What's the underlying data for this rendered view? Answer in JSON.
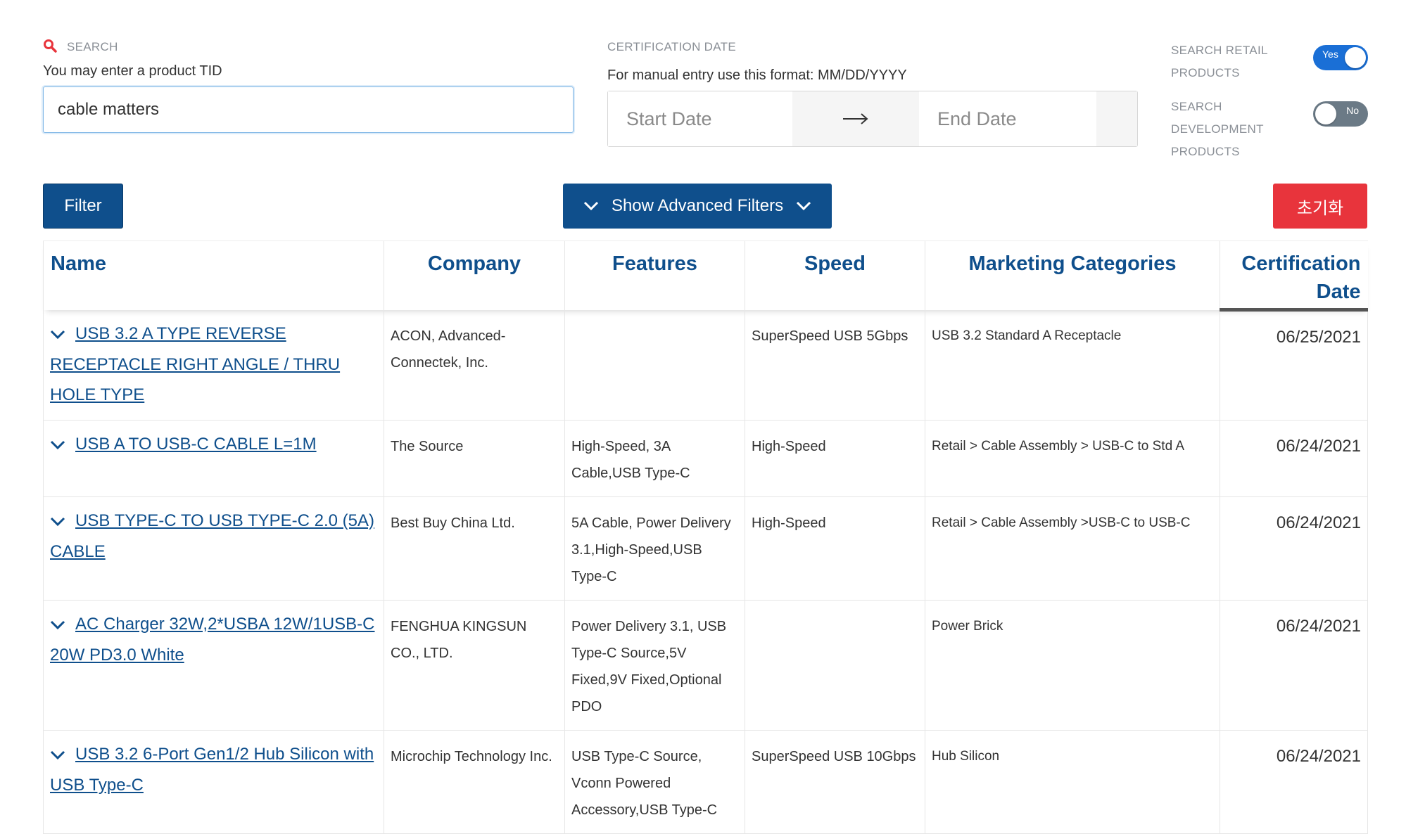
{
  "search": {
    "label": "SEARCH",
    "hint": "You may enter a product TID",
    "value": "cable matters"
  },
  "cert_date": {
    "label": "CERTIFICATION DATE",
    "hint": "For manual entry use this format: MM/DD/YYYY",
    "start_placeholder": "Start Date",
    "end_placeholder": "End Date"
  },
  "toggles": {
    "retail_label": "SEARCH RETAIL PRODUCTS",
    "retail_state": "Yes",
    "dev_label": "SEARCH DEVELOPMENT PRODUCTS",
    "dev_state": "No"
  },
  "buttons": {
    "filter": "Filter",
    "advanced": "Show Advanced Filters",
    "reset": "초기화"
  },
  "colors": {
    "primary": "#0f4f8c",
    "reset": "#e8343c",
    "toggle_on": "#1a6fd6",
    "toggle_off": "#6b7a86"
  },
  "table": {
    "headers": [
      "Name",
      "Company",
      "Features",
      "Speed",
      "Marketing Categories",
      "Certification Date"
    ],
    "rows": [
      {
        "name": "USB 3.2 A TYPE REVERSE RECEPTACLE RIGHT ANGLE / THRU HOLE TYPE",
        "company": "ACON, Advanced-Connectek, Inc.",
        "features": "",
        "speed": "SuperSpeed USB 5Gbps",
        "categories": "USB 3.2 Standard A Receptacle",
        "date": "06/25/2021"
      },
      {
        "name": "USB A TO USB-C CABLE L=1M",
        "company": "The Source",
        "features": "High-Speed, 3A Cable,USB Type-C",
        "speed": "High-Speed",
        "categories": "Retail > Cable Assembly > USB-C to Std A",
        "date": "06/24/2021"
      },
      {
        "name": "USB TYPE-C TO USB TYPE-C 2.0 (5A) CABLE",
        "company": "Best Buy China Ltd.",
        "features": "5A Cable, Power Delivery 3.1,High-Speed,USB Type-C",
        "speed": "High-Speed",
        "categories": "Retail > Cable Assembly >USB-C to USB-C",
        "date": "06/24/2021"
      },
      {
        "name": "AC Charger 32W,2*USBA 12W/1USB-C 20W PD3.0 White",
        "company": "FENGHUA KINGSUN CO., LTD.",
        "features": "Power Delivery 3.1, USB Type-C Source,5V Fixed,9V Fixed,Optional PDO",
        "speed": "",
        "categories": "Power Brick",
        "date": "06/24/2021"
      },
      {
        "name": "USB 3.2 6-Port Gen1/2 Hub Silicon with USB Type-C",
        "company": "Microchip Technology Inc.",
        "features": "USB Type-C Source, Vconn Powered Accessory,USB Type-C",
        "speed": "SuperSpeed USB 10Gbps",
        "categories": "Hub Silicon",
        "date": "06/24/2021"
      }
    ]
  }
}
